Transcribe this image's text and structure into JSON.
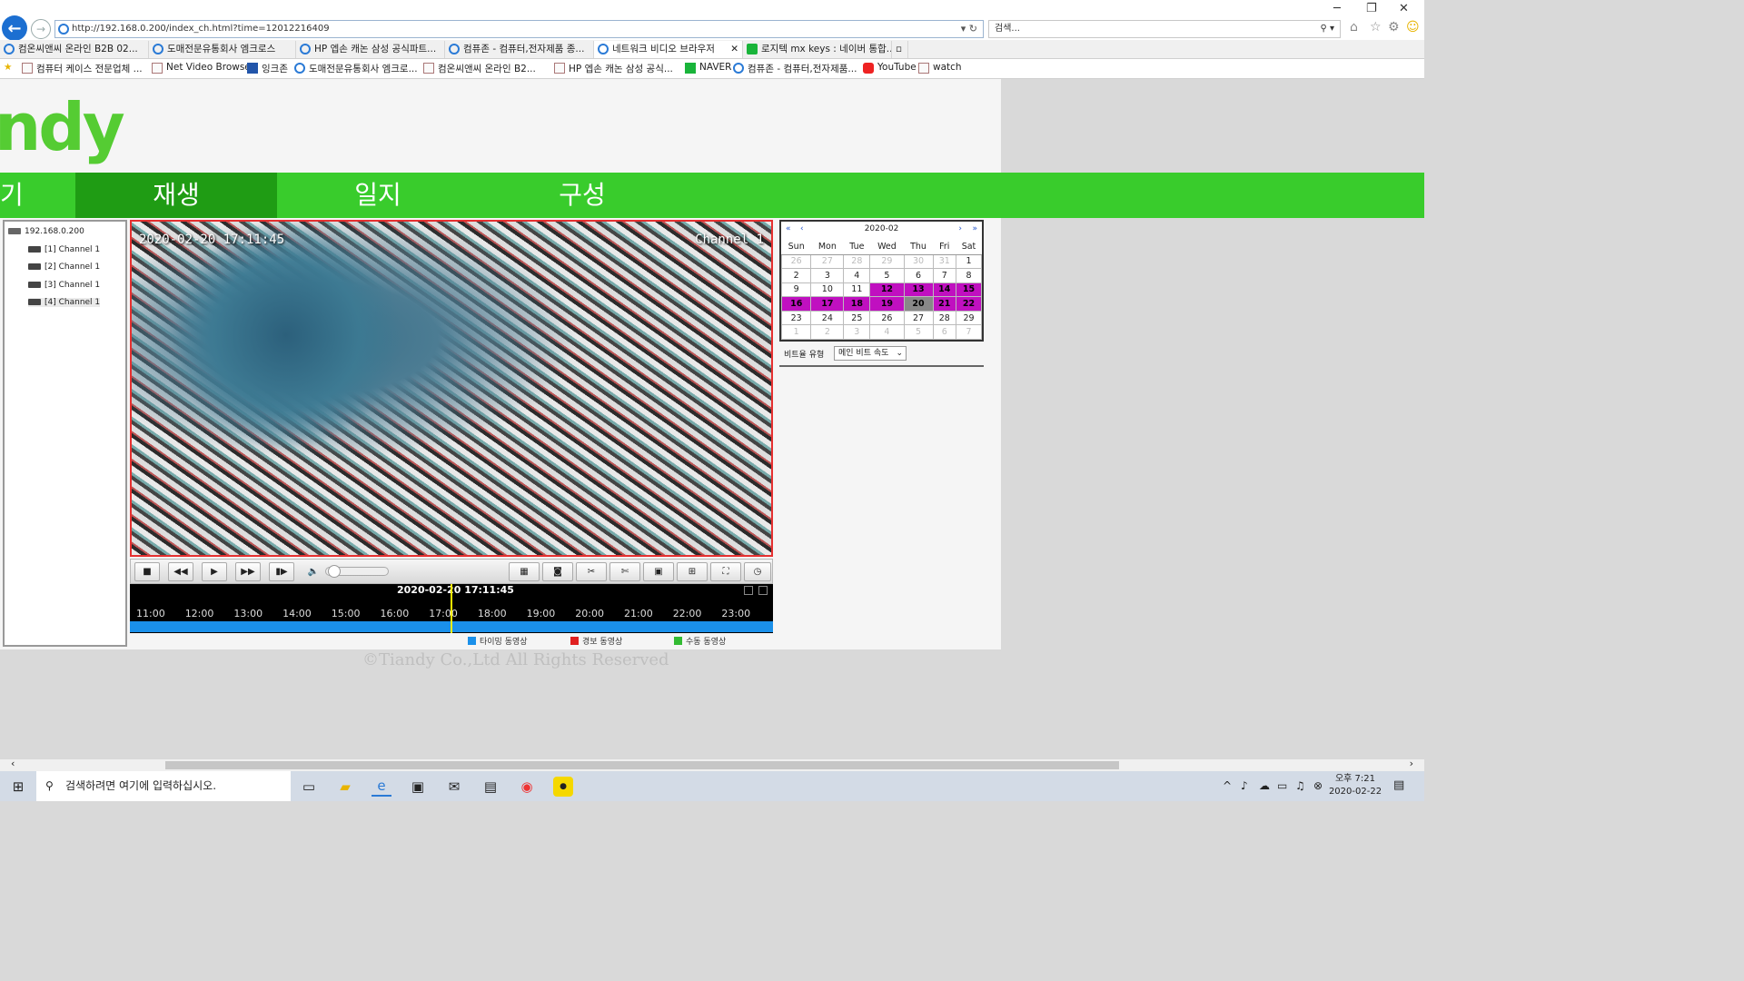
{
  "browser": {
    "url": "http://192.168.0.200/index_ch.html?time=12012216409",
    "search_placeholder": "검색...",
    "tabs": [
      "컴온씨앤씨 온라인 B2B 02...",
      "도매전문유통회사 엠크로스",
      "HP 엡손 캐논 삼성 공식파트...",
      "컴퓨존 - 컴퓨터,전자제품 종...",
      "네트워크 비디오 브라우저",
      "로지텍 mx keys : 네이버 통합..."
    ],
    "active_tab_index": 4,
    "favorites": [
      "컴퓨터 케이스 전문업체 ...",
      "Net Video Browser",
      "잉크존",
      "도매전문유통회사 엠크로...",
      "컴온씨앤씨 온라인 B2...",
      "HP 엡손 캐논 삼성 공식...",
      "NAVER",
      "컴퓨존 - 컴퓨터,전자제품...",
      "YouTube",
      "watch"
    ]
  },
  "app": {
    "logo_text": "ndy",
    "menu": [
      "기",
      "재생",
      "일지",
      "구성"
    ],
    "active_menu_index": 1,
    "brand_color": "#39cc2c",
    "active_menu_color": "#1f9c14"
  },
  "tree": {
    "root": "192.168.0.200",
    "channels": [
      "[1] Channel 1",
      "[2] Channel 1",
      "[3] Channel 1",
      "[4] Channel 1"
    ]
  },
  "video": {
    "timestamp": "2020-02-20 17:11:45",
    "channel_label": "Channel 1"
  },
  "timeline": {
    "current": "2020-02-20 17:11:45",
    "hours": [
      "11:00",
      "12:00",
      "13:00",
      "14:00",
      "15:00",
      "16:00",
      "17:00",
      "18:00",
      "19:00",
      "20:00",
      "21:00",
      "22:00",
      "23:00"
    ],
    "legend": [
      {
        "label": "타이밍 동영상",
        "color": "#1a90ea"
      },
      {
        "label": "경보 동영상",
        "color": "#e02020"
      },
      {
        "label": "수동 동영상",
        "color": "#33bb33"
      }
    ]
  },
  "calendar": {
    "month": "2020-02",
    "weekdays": [
      "Sun",
      "Mon",
      "Tue",
      "Wed",
      "Thu",
      "Fri",
      "Sat"
    ],
    "weeks": [
      [
        [
          "26",
          "o"
        ],
        [
          "27",
          "o"
        ],
        [
          "28",
          "o"
        ],
        [
          "29",
          "o"
        ],
        [
          "30",
          "o"
        ],
        [
          "31",
          "o"
        ],
        [
          "1",
          ""
        ]
      ],
      [
        [
          "2",
          ""
        ],
        [
          "3",
          ""
        ],
        [
          "4",
          ""
        ],
        [
          "5",
          ""
        ],
        [
          "6",
          ""
        ],
        [
          "7",
          ""
        ],
        [
          "8",
          ""
        ]
      ],
      [
        [
          "9",
          ""
        ],
        [
          "10",
          ""
        ],
        [
          "11",
          ""
        ],
        [
          "12",
          "r"
        ],
        [
          "13",
          "r"
        ],
        [
          "14",
          "r"
        ],
        [
          "15",
          "r"
        ]
      ],
      [
        [
          "16",
          "r"
        ],
        [
          "17",
          "r"
        ],
        [
          "18",
          "r"
        ],
        [
          "19",
          "r"
        ],
        [
          "20",
          "t"
        ],
        [
          "21",
          "r"
        ],
        [
          "22",
          "r"
        ]
      ],
      [
        [
          "23",
          ""
        ],
        [
          "24",
          ""
        ],
        [
          "25",
          ""
        ],
        [
          "26",
          ""
        ],
        [
          "27",
          ""
        ],
        [
          "28",
          ""
        ],
        [
          "29",
          ""
        ]
      ],
      [
        [
          "1",
          "o"
        ],
        [
          "2",
          "o"
        ],
        [
          "3",
          "o"
        ],
        [
          "4",
          "o"
        ],
        [
          "5",
          "o"
        ],
        [
          "6",
          "o"
        ],
        [
          "7",
          "o"
        ]
      ]
    ],
    "record_color": "#c010c0"
  },
  "bitstream": {
    "label": "비트율 유형",
    "value": "메인 비트 속도"
  },
  "footer": {
    "copyright": "©Tiandy Co.,Ltd All Rights Reserved"
  },
  "taskbar": {
    "search_placeholder": "검색하려면 여기에 입력하십시오.",
    "time": "오후 7:21",
    "date": "2020-02-22"
  }
}
